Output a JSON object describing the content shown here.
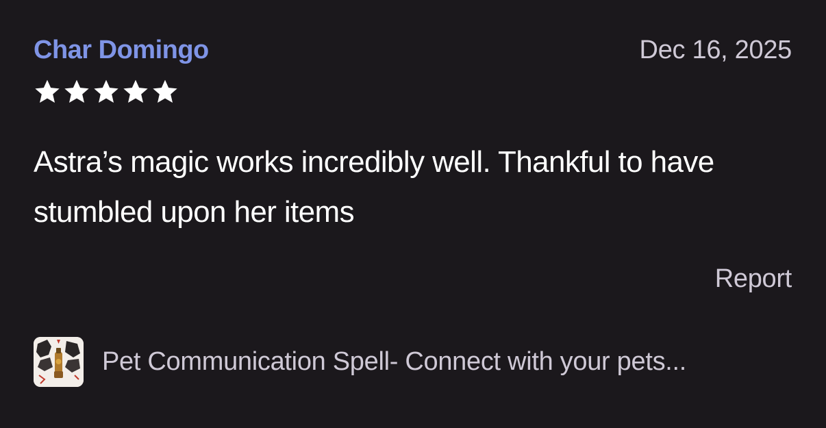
{
  "review": {
    "reviewer_name": "Char Domingo",
    "date": "Dec 16, 2025",
    "rating": 5,
    "rating_max": 5,
    "text": "Astra’s magic works incredibly well. Thankful to have stumbled upon her items",
    "report_label": "Report"
  },
  "product": {
    "title": "Pet Communication Spell- Connect with your pets...",
    "thumbnail_icon": "product-thumbnail-image"
  },
  "colors": {
    "background": "#1b181c",
    "reviewer_name": "#7f94e6",
    "secondary_text": "#cfc9d6",
    "body_text": "#ffffff",
    "star": "#ffffff"
  }
}
